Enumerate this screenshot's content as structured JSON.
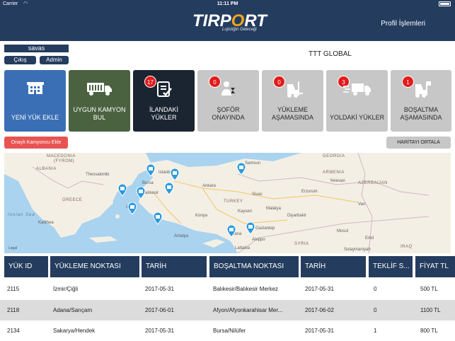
{
  "status_bar": {
    "carrier": "Carrier",
    "time": "11:11 PM"
  },
  "header": {
    "logo_text": "TIRPORT",
    "logo_tagline": "Lojistiğin Geleceği",
    "profile_menu": "Profil İşlemleri"
  },
  "user": {
    "name": "savas",
    "logout": "Çıkış",
    "admin": "Admin"
  },
  "company": "TTT GLOBAL",
  "tiles": [
    {
      "label_lines": [
        "YENİ YÜK EKLE"
      ],
      "color": "#3b6fb5",
      "icon": "building-icon"
    },
    {
      "label_lines": [
        "UYGUN KAMYON",
        "BUL"
      ],
      "color": "#4b6240",
      "icon": "truck-icon"
    },
    {
      "label_lines": [
        "İLANDAKİ",
        "YÜKLER"
      ],
      "color": "#1b2532",
      "icon": "checklist-icon",
      "badge": "17"
    },
    {
      "label_lines": [
        "ŞOFÖR",
        "ONAYINDA"
      ],
      "color": "#c7c7c7",
      "icon": "driver-hourglass-icon",
      "badge": "0"
    },
    {
      "label_lines": [
        "YÜKLEME",
        "AŞAMASINDA"
      ],
      "color": "#c7c7c7",
      "icon": "forklift-icon",
      "badge": "0"
    },
    {
      "label_lines": [
        "YOLDAKİ YÜKLER"
      ],
      "color": "#c7c7c7",
      "icon": "moving-truck-icon",
      "badge": "3"
    },
    {
      "label_lines": [
        "BOŞALTMA",
        "AŞAMASINDA"
      ],
      "color": "#c7c7c7",
      "icon": "forklift-unload-icon",
      "badge": "1"
    }
  ],
  "buttons": {
    "approved_trucker": "Onaylı Kamyoncu Ekle",
    "center_map": "HARİTAYI ORTALA"
  },
  "map": {
    "legal": "Legal",
    "labels": [
      "MACEDONIA",
      "(FYROM)",
      "ALBANIA",
      "Thessaloniki",
      "Ionian Sea",
      "GREECE",
      "Kalithea",
      "Istanbul",
      "Bursa",
      "Izmir",
      "Balıkesir",
      "Antalya",
      "Ankara",
      "TURKEY",
      "Konya",
      "Sivas",
      "Samsun",
      "Erzurum",
      "Malatya",
      "Diyarbakir",
      "Gaziantep",
      "Aleppo",
      "Lattakia",
      "SYRIA",
      "Kayseri",
      "Adana",
      "Van",
      "Mosul",
      "Erbil",
      "Sulaymaniyah",
      "GEORGIA",
      "ARMENIA",
      "AZERBAIJAN",
      "Yerevan",
      "IRAQ"
    ]
  },
  "table": {
    "headers": [
      "YÜK ID",
      "YÜKLEME NOKTASI",
      "TARİH",
      "BOŞALTMA NOKTASI",
      "TARİH",
      "TEKLİF S...",
      "FİYAT TL"
    ],
    "rows": [
      [
        "2115",
        "İzmir/Çiğli",
        "2017-05-31",
        "Balıkesir/Balıkesir Merkez",
        "2017-05-31",
        "0",
        "500 TL"
      ],
      [
        "2118",
        "Adana/Sarıçam",
        "2017-06-01",
        "Afyon/Afyonkarahisar Mer...",
        "2017-06-02",
        "0",
        "1100 TL"
      ],
      [
        "2134",
        "Sakarya/Hendek",
        "2017-05-31",
        "Bursa/Nilüfer",
        "2017-05-31",
        "1",
        "800 TL"
      ]
    ]
  },
  "colors": {
    "header_bg": "#243c5e",
    "badge": "#e21b1b",
    "logo_accent": "#f2a41b",
    "marker": "#2b9be0"
  }
}
